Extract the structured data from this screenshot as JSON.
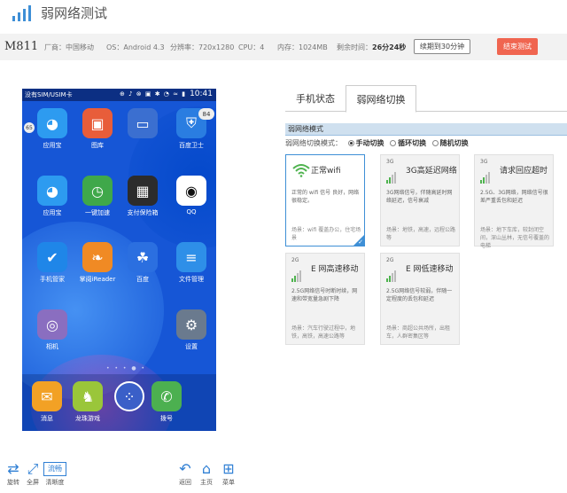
{
  "app": {
    "title": "弱网络测试"
  },
  "device": {
    "model": "M811",
    "vendor": "厂商：中国移动",
    "os": "OS：Android 4.3",
    "resolution": "分辨率：720x1280",
    "cpu": "CPU：4",
    "memory": "内存：1024MB",
    "remaining_label": "剩余时间：",
    "remaining_value": "26分24秒",
    "extend_button": "续期到30分钟",
    "end_button": "结束测试"
  },
  "phone": {
    "status_bar": {
      "carrier": "没有SIM/USIM卡",
      "icons": "⊕ ♪ ⊗ ▣ ✱ ◔ ≈ ▮",
      "time": "10:41"
    },
    "badges": {
      "security": "84",
      "left": "65"
    },
    "apps": [
      {
        "label": "应用宝",
        "icon": "app-store-icon",
        "color": "#2d9bf0"
      },
      {
        "label": "图库",
        "icon": "gallery-icon",
        "color": "#e85d3a"
      },
      {
        "label": "",
        "icon": "folder-icon",
        "color": "#3b6fd0"
      },
      {
        "label": "百度卫士",
        "icon": "shield-icon",
        "color": "#2a7de1"
      },
      {
        "label": "应用宝",
        "icon": "app-store-icon",
        "color": "#2d9bf0"
      },
      {
        "label": "一键加速",
        "icon": "speedometer-icon",
        "color": "#3fa84a"
      },
      {
        "label": "支付保险箱",
        "icon": "safe-icon",
        "color": "#2c2c2c"
      },
      {
        "label": "QQ",
        "icon": "qq-penguin-icon",
        "color": "#ffffff"
      },
      {
        "label": "手机管家",
        "icon": "guard-icon",
        "color": "#1f86e8"
      },
      {
        "label": "掌阅iReader",
        "icon": "reader-icon",
        "color": "#f08a24"
      },
      {
        "label": "百度",
        "icon": "baidu-paw-icon",
        "color": "#2b6fe0"
      },
      {
        "label": "文件管理",
        "icon": "file-manager-icon",
        "color": "#2e8fe8"
      },
      {
        "label": "相机",
        "icon": "camera-icon",
        "color": "#8a6ec0"
      },
      {
        "label": "设置",
        "icon": "gear-icon",
        "color": "#6a7a8e"
      }
    ],
    "dock": [
      {
        "label": "消息",
        "icon": "message-icon",
        "color": "#f2a125"
      },
      {
        "label": "龙珠游戏",
        "icon": "android-icon",
        "color": "#9ac63a"
      },
      {
        "label": "",
        "icon": "app-drawer-icon",
        "color": "#3a5fc8"
      },
      {
        "label": "拨号",
        "icon": "phone-icon",
        "color": "#4cb050"
      }
    ],
    "page_dots": "• • • ● •"
  },
  "toolbar": {
    "rotate": "旋转",
    "fullscreen": "全屏",
    "hd": "清晰度",
    "back": "返回",
    "home": "主页",
    "menu": "菜单",
    "hd_icon_text": "流畅"
  },
  "panel": {
    "tabs": [
      {
        "label": "手机状态"
      },
      {
        "label": "弱网络切换"
      }
    ],
    "section_title": "弱网络模式",
    "mode_label": "弱网络切换模式：",
    "modes": [
      "手动切换",
      "循环切换",
      "随机切换"
    ],
    "cards": [
      {
        "gen": "",
        "title": "正常wifi",
        "desc": "正常的 wifi 信号 良好，网络很稳定。",
        "scene": "场景：wifi 覆盖办公，住宅场景",
        "selected": true
      },
      {
        "gen": "3G",
        "title": "3G高延迟网络",
        "desc": "3G网络信号，伴随高延时网络延迟，信号衰减",
        "scene": "场景：地铁，高速，远程公路等",
        "selected": false
      },
      {
        "gen": "3G",
        "title": "请求回应超时",
        "desc": "2.5G、3G网络，网络信号很差严重丢包和延迟",
        "scene": "场景：地下车库，较封闭空间，深山丛林，无信号覆盖的电梯",
        "selected": false
      },
      {
        "gen": "2G",
        "title": "E 网高速移动",
        "desc": "2.5G网络信号时断时续，网速和带宽量急剧下降",
        "scene": "场景：汽车行驶过程中，地铁，高铁，高速公路等",
        "selected": false
      },
      {
        "gen": "2G",
        "title": "E 网低速移动",
        "desc": "2.5G网络信号较弱，伴随一定程度的丢包和延迟",
        "scene": "场景：商超公共场所，出租车，人群密集区等",
        "selected": false
      }
    ],
    "accent": "#3e8fd6"
  }
}
